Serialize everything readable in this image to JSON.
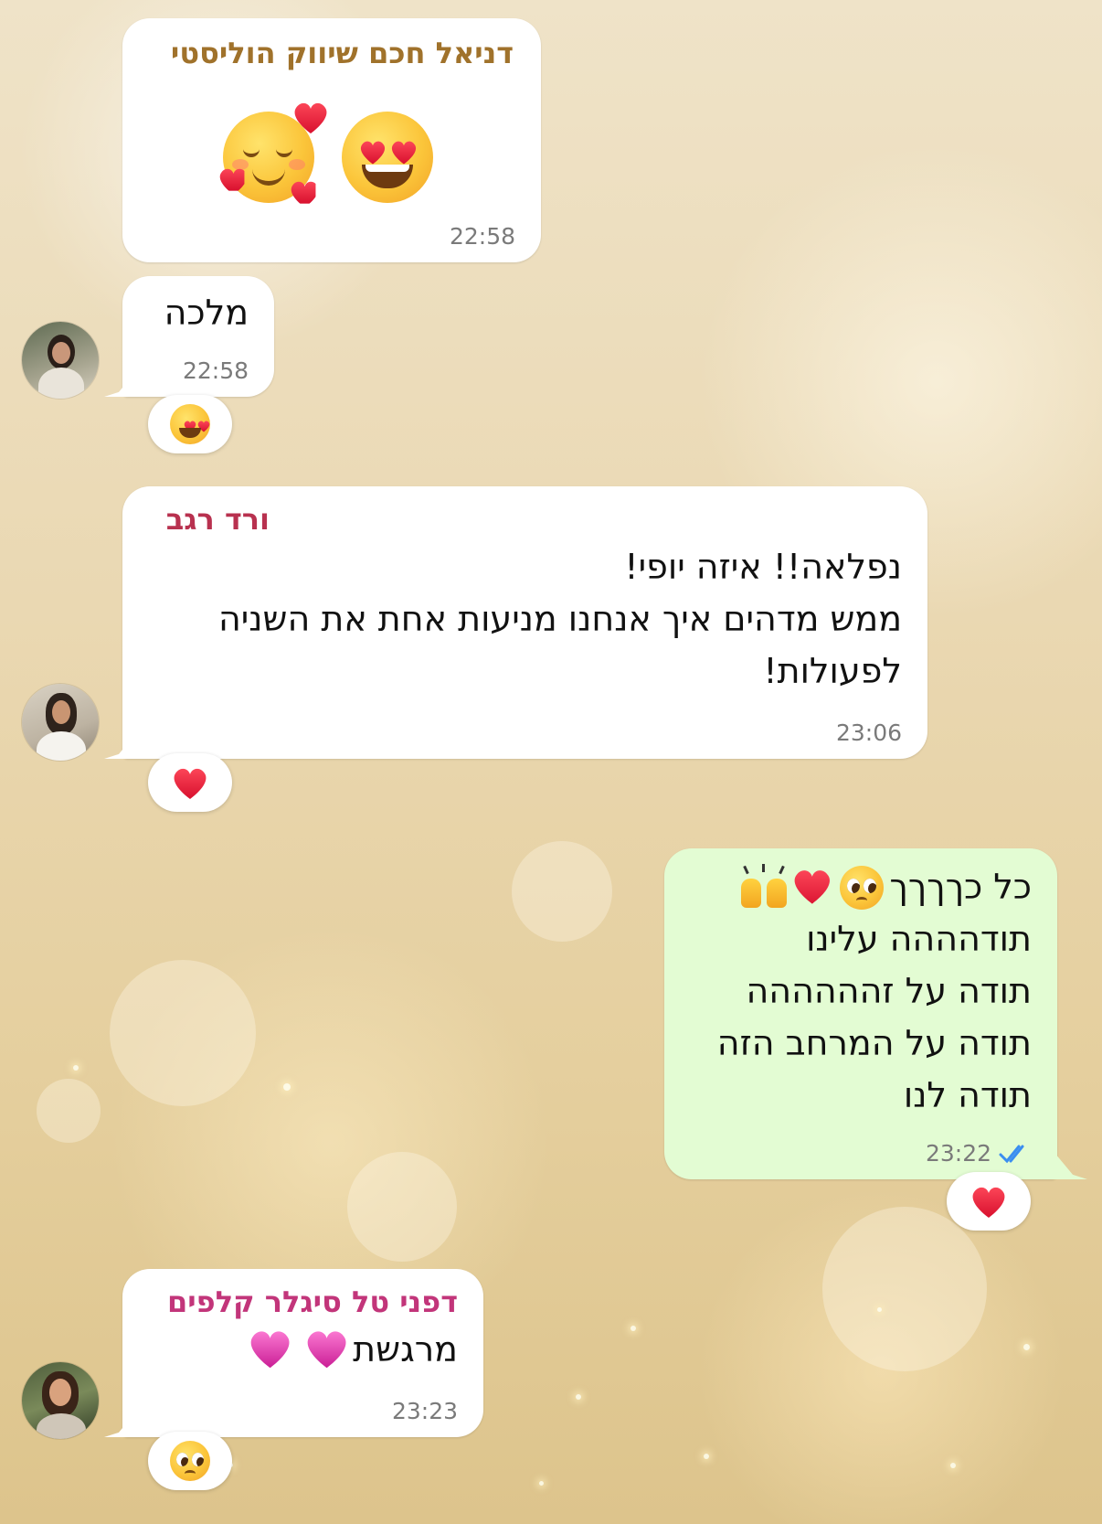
{
  "messages": [
    {
      "sender": "דניאל חכם שיווק הוליסטי",
      "sender_color": "#a0722b",
      "emoji": [
        "smiling-face-with-heart-eyes",
        "smiling-face-with-hearts"
      ],
      "time": "22:58"
    },
    {
      "text": "מלכה",
      "time": "22:58",
      "reaction": "smiling-face-with-heart-eyes"
    },
    {
      "sender": "ורד רגב",
      "sender_color": "#b8314f",
      "text": "נפלאה!! איזה יופי!\nממש מדהים איך אנחנו מניעות אחת את השניה\nלפעולות!",
      "time": "23:06",
      "reaction": "red-heart"
    },
    {
      "outgoing": true,
      "text_first_line": "כל כךךךך",
      "text_first_line_emoji": [
        "pleading-face",
        "red-heart",
        "raising-hands"
      ],
      "text": "תודהההה עלינו\nתודה על זהההההה\nתודה על המרחב הזה\nתודה לנו",
      "time": "23:22",
      "status": "read-double-check",
      "reaction": "red-heart"
    },
    {
      "sender": "דפני טל סיגלר קלפים",
      "sender_color": "#c2357a",
      "text": "מרגשת",
      "text_emoji": [
        "pink-heart",
        "pink-heart"
      ],
      "time": "23:23",
      "reaction": "pleading-face"
    }
  ],
  "colors": {
    "incoming_bubble": "#ffffff",
    "outgoing_bubble": "#e3fcd3",
    "timestamp": "#7a7a7a",
    "read_check": "#3b8ef0"
  }
}
